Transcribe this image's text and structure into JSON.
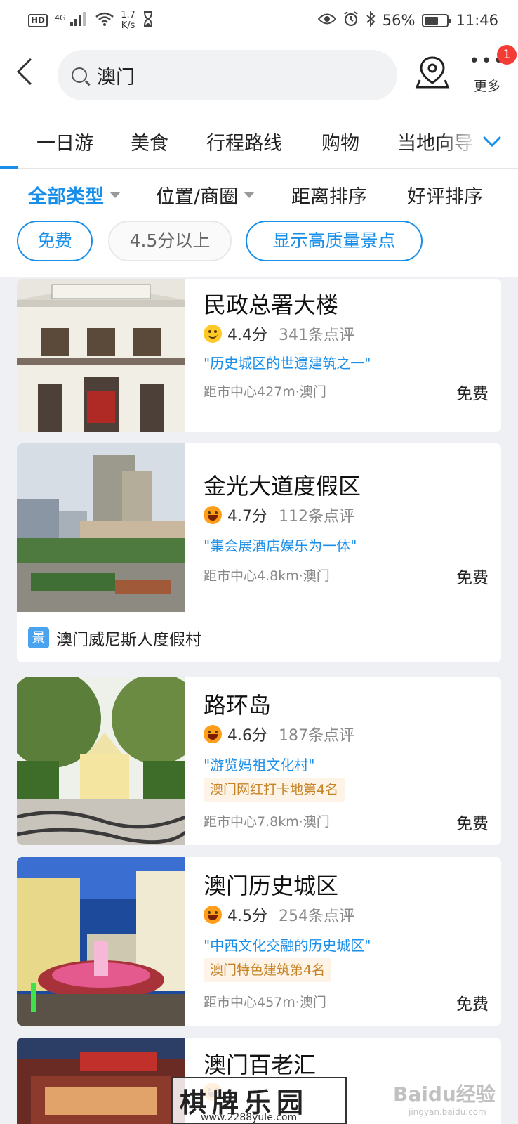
{
  "status_bar": {
    "hd": "HD",
    "network": "4G",
    "speed_value": "1.7",
    "speed_unit": "K/s",
    "battery": "56%",
    "battery_level": 0.56,
    "time": "11:46"
  },
  "header": {
    "search_query": "澳门",
    "more_label": "更多",
    "more_badge": "1"
  },
  "tabs": [
    {
      "label": "一日游"
    },
    {
      "label": "美食"
    },
    {
      "label": "行程路线"
    },
    {
      "label": "购物"
    },
    {
      "label": "当地向导"
    }
  ],
  "filters": {
    "type": "全部类型",
    "location": "位置/商圈",
    "distance": "距离排序",
    "rating": "好评排序",
    "chips": [
      "免费",
      "4.5分以上",
      "显示高质量景点"
    ]
  },
  "cards": [
    {
      "title": "民政总署大楼",
      "score": "4.4分",
      "reviews": "341条点评",
      "quote": "\"历史城区的世遗建筑之一\"",
      "distance": "距市中心427m·澳门",
      "price": "免费",
      "face": "smile"
    },
    {
      "title": "金光大道度假区",
      "score": "4.7分",
      "reviews": "112条点评",
      "quote": "\"集会展酒店娱乐为一体\"",
      "distance": "距市中心4.8km·澳门",
      "price": "免费",
      "face": "laugh",
      "related_icon": "景",
      "related": "澳门威尼斯人度假村"
    },
    {
      "title": "路环岛",
      "score": "4.6分",
      "reviews": "187条点评",
      "quote": "\"游览妈祖文化村\"",
      "tag": "澳门网红打卡地第4名",
      "distance": "距市中心7.8km·澳门",
      "price": "免费",
      "face": "laugh"
    },
    {
      "title": "澳门历史城区",
      "score": "4.5分",
      "reviews": "254条点评",
      "quote": "\"中西文化交融的历史城区\"",
      "tag": "澳门特色建筑第4名",
      "distance": "距市中心457m·澳门",
      "price": "免费",
      "face": "laugh"
    },
    {
      "title": "澳门百老汇",
      "face": "laugh"
    }
  ],
  "watermarks": {
    "site_title": "棋牌乐园",
    "site_url": "www.2288yule.com",
    "baidu": "Baidu经验",
    "baidu_url": "jingyan.baidu.com"
  },
  "colors": {
    "accent": "#1a8fea",
    "tag_text": "#c78427",
    "tag_bg": "#fdf3e6",
    "badge": "#f43b36"
  }
}
